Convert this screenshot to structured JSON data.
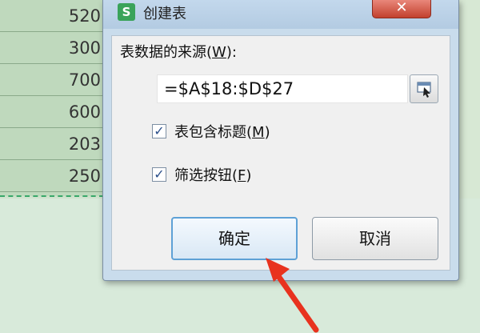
{
  "sheet": {
    "cells": [
      "520",
      "300",
      "700",
      "600",
      "203",
      "250"
    ]
  },
  "dialog": {
    "title": "创建表",
    "app_icon_letter": "S",
    "close_label": "✕",
    "source_label_prefix": "表数据的来源(",
    "source_label_key": "W",
    "source_label_suffix": "):",
    "range_value": "=$A$18:$D$27",
    "has_header": {
      "checked": true,
      "label_prefix": "表包含标题(",
      "label_key": "M",
      "label_suffix": ")"
    },
    "filter_button": {
      "checked": true,
      "label_prefix": "筛选按钮(",
      "label_key": "F",
      "label_suffix": ")"
    },
    "ok_label": "确定",
    "cancel_label": "取消"
  },
  "colors": {
    "annotation_arrow": "#e8321e",
    "app_icon": "#3aa35a",
    "close_button": "#c2402d"
  },
  "icons": {
    "app": "wps-spreadsheet-icon",
    "collapse": "range-select-icon",
    "checkmark": "check-icon",
    "annotation": "red-arrow-icon"
  }
}
